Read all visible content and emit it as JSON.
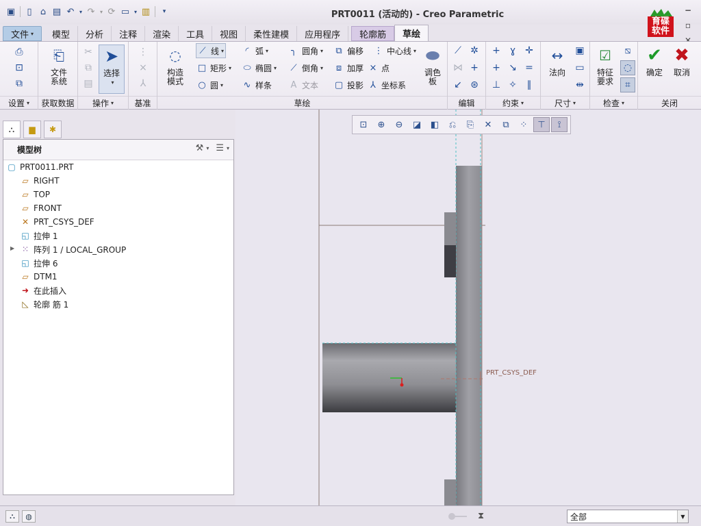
{
  "window": {
    "title": "PRT0011 (活动的) - Creo Parametric",
    "logo_text_line1": "育碟",
    "logo_text_line2": "软件",
    "minimize": "−",
    "restore": "▫",
    "close": "✕"
  },
  "tabs": [
    {
      "label": "文件",
      "dropdown": "▾"
    },
    {
      "label": "模型"
    },
    {
      "label": "分析"
    },
    {
      "label": "注释"
    },
    {
      "label": "渲染"
    },
    {
      "label": "工具"
    },
    {
      "label": "视图"
    },
    {
      "label": "柔性建模"
    },
    {
      "label": "应用程序"
    },
    {
      "label": "轮廓筋"
    },
    {
      "label": "草绘"
    }
  ],
  "ribbon": {
    "groups": {
      "setup": "设置",
      "get_data": "获取数据",
      "operations": "操作",
      "datum": "基准",
      "sketch": "草绘",
      "edit": "编辑",
      "constrain": "约束",
      "dimension": "尺寸",
      "inspect": "检查",
      "close": "关闭"
    },
    "file_system": "文件\n系统",
    "select": "选择",
    "construction_mode": "构造\n模式",
    "line": "线",
    "rectangle": "矩形",
    "circle": "圆",
    "arc": "弧",
    "ellipse": "椭圆",
    "spline": "样条",
    "fillet": "圆角",
    "chamfer": "倒角",
    "text": "文本",
    "offset": "偏移",
    "thicken": "加厚",
    "project": "投影",
    "centerline": "中心线",
    "point": "点",
    "coordinate_system": "坐标系",
    "palette": "调色\n板",
    "normal": "法向",
    "feature_requirements": "特征\n要求",
    "ok": "确定",
    "cancel": "取消"
  },
  "model_tree": {
    "header": "模型树",
    "items": [
      {
        "label": "PRT0011.PRT",
        "icon": "part-icon"
      },
      {
        "label": "RIGHT",
        "icon": "datum-plane-icon"
      },
      {
        "label": "TOP",
        "icon": "datum-plane-icon"
      },
      {
        "label": "FRONT",
        "icon": "datum-plane-icon"
      },
      {
        "label": "PRT_CSYS_DEF",
        "icon": "csys-icon"
      },
      {
        "label": "拉伸 1",
        "icon": "extrude-icon"
      },
      {
        "label": "阵列 1 / LOCAL_GROUP",
        "icon": "pattern-icon"
      },
      {
        "label": "拉伸 6",
        "icon": "extrude-icon"
      },
      {
        "label": "DTM1",
        "icon": "datum-plane-icon"
      },
      {
        "label": "在此插入",
        "icon": "insert-here-icon"
      },
      {
        "label": "轮廓 筋 1",
        "icon": "profile-rib-icon"
      }
    ]
  },
  "graphics": {
    "csys_label": "PRT_CSYS_DEF"
  },
  "statusbar": {
    "filter_value": "全部"
  },
  "colors": {
    "accent_blue": "#1f4d98",
    "ok_green": "#1e9a2a",
    "cancel_red": "#c0141c",
    "part_gray": "#8a8a8e",
    "background": "#e9e6ef"
  }
}
